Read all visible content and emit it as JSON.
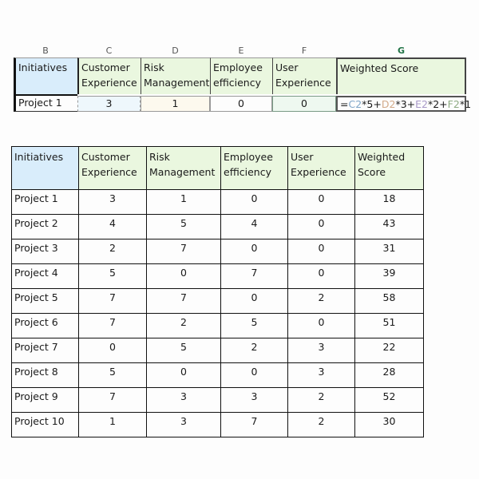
{
  "excel_snippet": {
    "column_letters": [
      "B",
      "C",
      "D",
      "E",
      "F",
      "G"
    ],
    "selected_column": "G",
    "headers": [
      "Initiatives",
      "Customer Experience",
      "Risk Management",
      "Employee efficiency",
      "User Experience",
      "Weighted Score"
    ],
    "headers_lines": [
      [
        "Initiatives"
      ],
      [
        "Customer",
        "Experience"
      ],
      [
        "Risk",
        "Management"
      ],
      [
        "Employee",
        "efficiency"
      ],
      [
        "User",
        "Experience"
      ],
      [
        "Weighted Score"
      ]
    ],
    "row": {
      "initiative": "Project 1",
      "customer_experience": "3",
      "risk_management": "1",
      "employee_efficiency": "0",
      "user_experience": "0",
      "formula": {
        "prefix": "=",
        "parts": [
          {
            "ref": "C2",
            "op": "*5+"
          },
          {
            "ref": "D2",
            "op": "*3+"
          },
          {
            "ref": "E2",
            "op": "*2+"
          },
          {
            "ref": "F2",
            "op": "*1"
          }
        ]
      }
    }
  },
  "table": {
    "headers_lines": [
      [
        "Initiatives"
      ],
      [
        "Customer",
        "Experience"
      ],
      [
        "Risk",
        "Management"
      ],
      [
        "Employee",
        "efficiency"
      ],
      [
        "User",
        "Experience"
      ],
      [
        "Weighted",
        "Score"
      ]
    ],
    "rows": [
      [
        "Project 1",
        "3",
        "1",
        "0",
        "0",
        "18"
      ],
      [
        "Project 2",
        "4",
        "5",
        "4",
        "0",
        "43"
      ],
      [
        "Project 3",
        "2",
        "7",
        "0",
        "0",
        "31"
      ],
      [
        "Project 4",
        "5",
        "0",
        "7",
        "0",
        "39"
      ],
      [
        "Project 5",
        "7",
        "7",
        "0",
        "2",
        "58"
      ],
      [
        "Project 6",
        "7",
        "2",
        "5",
        "0",
        "51"
      ],
      [
        "Project 7",
        "0",
        "5",
        "2",
        "3",
        "22"
      ],
      [
        "Project 8",
        "5",
        "0",
        "0",
        "3",
        "28"
      ],
      [
        "Project 9",
        "7",
        "3",
        "3",
        "2",
        "52"
      ],
      [
        "Project 10",
        "1",
        "3",
        "7",
        "2",
        "30"
      ]
    ]
  },
  "colors": {
    "header_blue": "#d9edfb",
    "header_green": "#eaf7df",
    "selected_column": "#217346"
  }
}
